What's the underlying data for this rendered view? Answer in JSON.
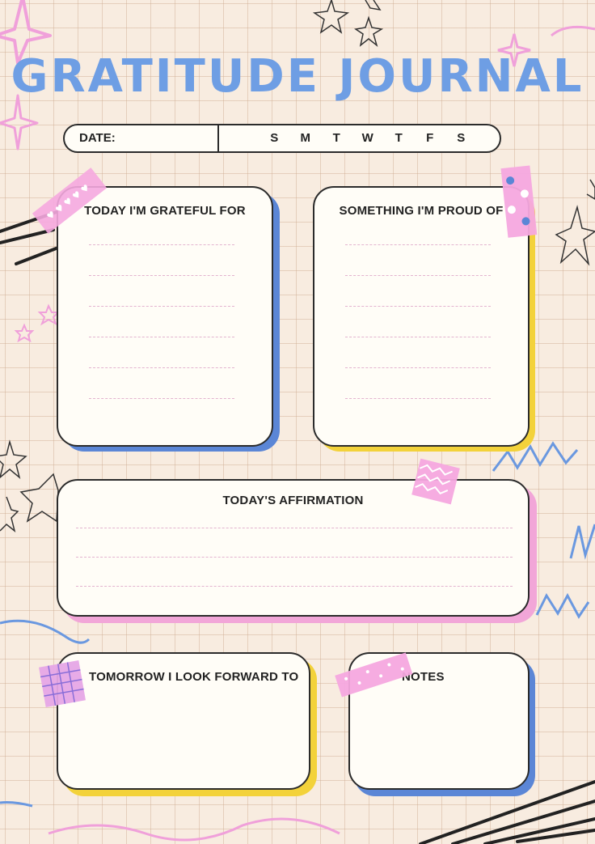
{
  "title": "GRATITUDE JOURNAL",
  "date_label": "DATE:",
  "weekdays": [
    "S",
    "M",
    "T",
    "W",
    "T",
    "F",
    "S"
  ],
  "sections": {
    "grateful": "TODAY I'M GRATEFUL FOR",
    "proud": "SOMETHING I'M PROUD OF",
    "affirmation": "TODAY'S AFFIRMATION",
    "tomorrow": "TOMORROW I LOOK FORWARD TO",
    "notes": "NOTES"
  },
  "colors": {
    "title": "#6e9ee4",
    "blue": "#5b86d6",
    "yellow": "#f3d23a",
    "pink": "#f2a6d8",
    "tape_pink": "#f5a8df",
    "grid": "#cfab92",
    "background": "#f8ece0"
  },
  "icons": [
    "star-icon",
    "sparkle-icon",
    "flower-icon",
    "scribble-icon"
  ]
}
